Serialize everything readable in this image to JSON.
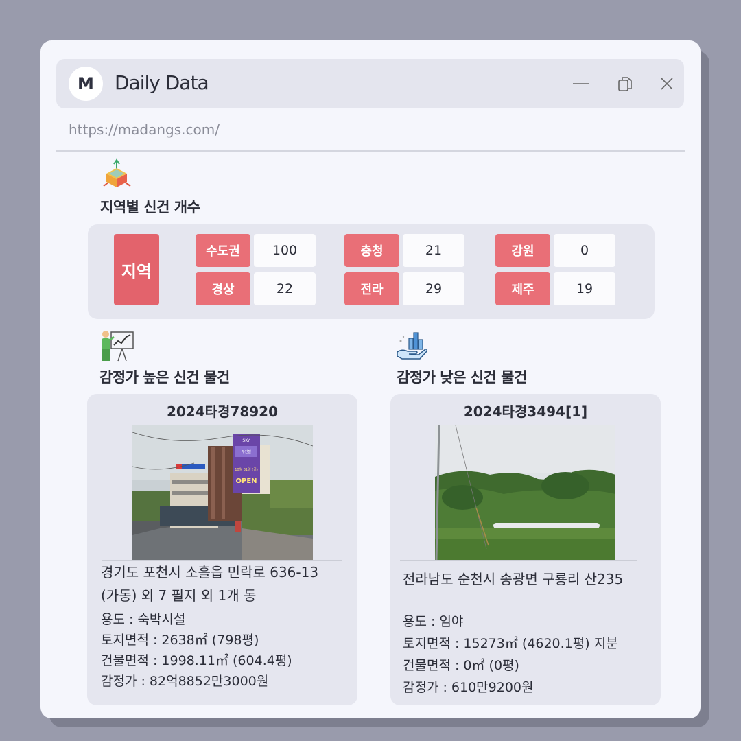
{
  "window": {
    "logo_letter": "M",
    "title": "Daily Data",
    "url": "https://madangs.com/"
  },
  "region_section": {
    "title": "지역별 신건 개수",
    "main_label": "지역",
    "regions": [
      {
        "name": "수도권",
        "count": "100"
      },
      {
        "name": "경상",
        "count": "22"
      },
      {
        "name": "충청",
        "count": "21"
      },
      {
        "name": "전라",
        "count": "29"
      },
      {
        "name": "강원",
        "count": "0"
      },
      {
        "name": "제주",
        "count": "19"
      }
    ]
  },
  "high_section": {
    "title": "감정가 높은 신건 물건",
    "case_no": "2024타경78920",
    "address_line1": "경기도 포천시 소흘읍 민락로 636-13",
    "address_line2": "(가동) 외 7 필지 외 1개 동",
    "usage": "용도 : 숙박시설",
    "land_area": "토지면적 : 2638㎡ (798평)",
    "building_area": "건물면적 : 1998.11㎡ (604.4평)",
    "appraisal": "감정가 : 82억8852만3000원",
    "sign_text": [
      "SKY",
      "무인텔",
      "10월 31일 (금)",
      "OPEN"
    ]
  },
  "low_section": {
    "title": "감정가 낮은 신건 물건",
    "case_no": "2024타경3494[1]",
    "address_line1": "전라남도 순천시 송광면 구룡리 산235",
    "usage": "용도 : 임야",
    "land_area": "토지면적 : 15273㎡ (4620.1평) 지분",
    "building_area": "건물면적 : 0㎡ (0평)",
    "appraisal": "감정가 : 610만9200원"
  },
  "colors": {
    "background": "#999bac",
    "window": "#f5f6fc",
    "panel": "#e5e6ef",
    "chip": "#e96f77",
    "region_main": "#e3636c"
  },
  "icons": [
    "minimize-icon",
    "copy-icon",
    "close-icon",
    "cube-axes-icon",
    "presentation-chart-icon",
    "hand-bar-chart-icon"
  ]
}
